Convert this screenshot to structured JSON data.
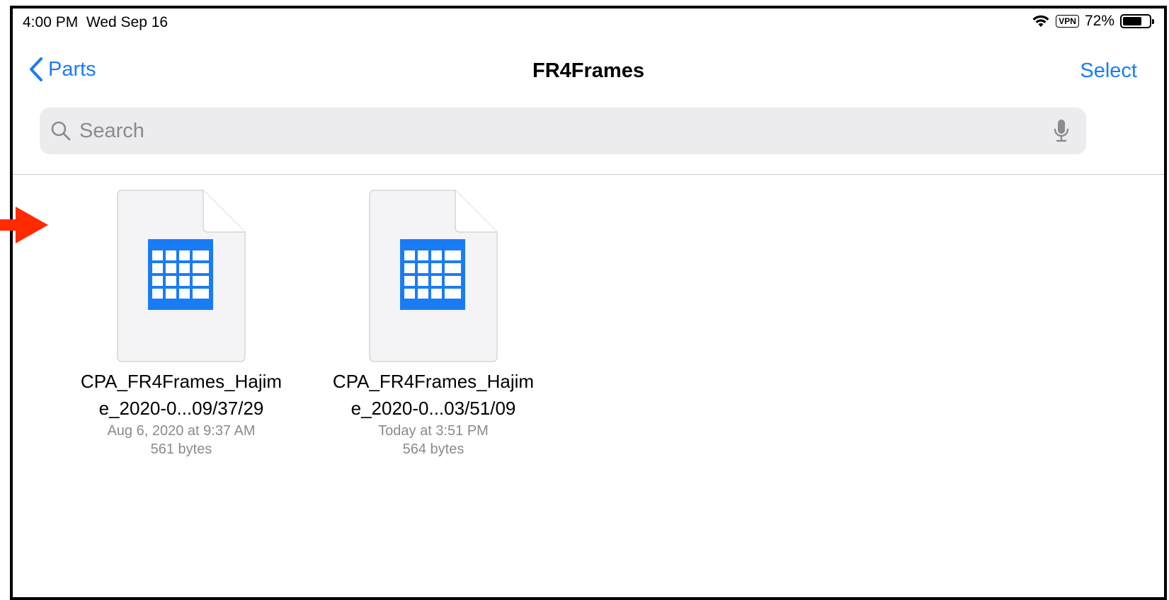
{
  "status_bar": {
    "time": "4:00 PM",
    "date": "Wed Sep 16",
    "vpn": "VPN",
    "battery": "72%",
    "battery_level": 0.72
  },
  "nav": {
    "back_label": "Parts",
    "title": "FR4Frames",
    "select_label": "Select"
  },
  "search": {
    "placeholder": "Search"
  },
  "files": [
    {
      "name_line1": "CPA_FR4Frames_Hajim",
      "name_line2": "e_2020-0...09/37/29",
      "date": "Aug 6, 2020 at 9:37 AM",
      "size": "561 bytes"
    },
    {
      "name_line1": "CPA_FR4Frames_Hajim",
      "name_line2": "e_2020-0...03/51/09",
      "date": "Today at 3:51 PM",
      "size": "564 bytes"
    }
  ],
  "colors": {
    "accent": "#1a7cf5",
    "annotation_arrow": "#ff2a00"
  }
}
